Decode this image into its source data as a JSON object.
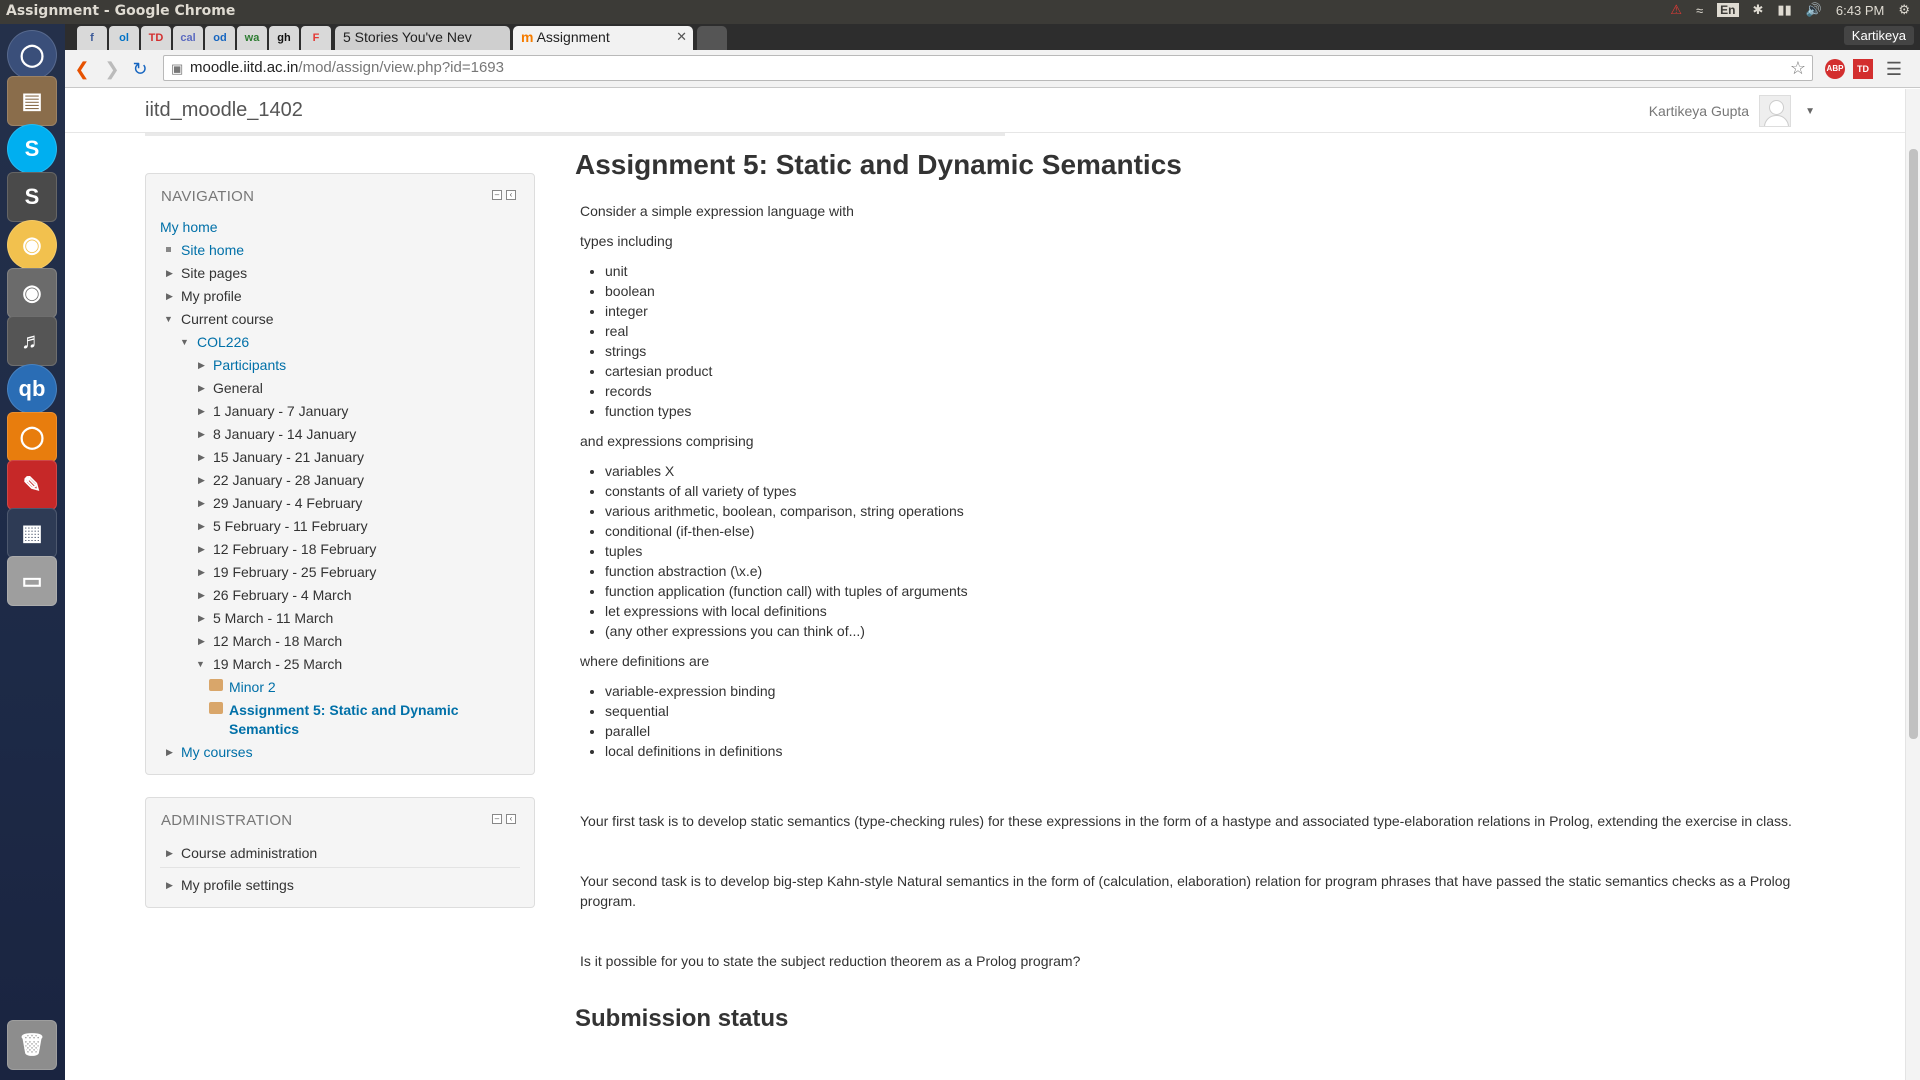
{
  "topbar": {
    "window_title": "Assignment - Google Chrome",
    "lang": "En",
    "time": "6:43 PM"
  },
  "launcher": {
    "apps": [
      "dash",
      "files",
      "skype",
      "sublime-text",
      "chrome",
      "rhythmbox",
      "volume",
      "qbittorrent",
      "blender",
      "evince",
      "workspace-switcher",
      "disk",
      "trash"
    ]
  },
  "chrome": {
    "user": "Kartikeya",
    "pinned_tabs": [
      "f",
      "ol",
      "TD",
      "cal",
      "od",
      "wa",
      "gh",
      "F"
    ],
    "tabs": [
      {
        "label": "5 Stories You've Nev"
      },
      {
        "label": "Assignment"
      }
    ],
    "url_host": "moodle.iitd.ac.in",
    "url_path": "/mod/assign/view.php?id=1693"
  },
  "moodle": {
    "site_name": "iitd_moodle_1402",
    "user_name": "Kartikeya Gupta"
  },
  "navigation": {
    "title": "NAVIGATION",
    "items": [
      {
        "label": "My home",
        "type": "link"
      },
      {
        "label": "Site home",
        "type": "link"
      },
      {
        "label": "Site pages",
        "type": "text"
      },
      {
        "label": "My profile",
        "type": "text"
      },
      {
        "label": "Current course",
        "type": "text"
      },
      {
        "label": "COL226",
        "type": "link"
      },
      {
        "label": "Participants",
        "type": "link"
      },
      {
        "label": "General",
        "type": "text"
      },
      {
        "label": "1 January - 7 January",
        "type": "text"
      },
      {
        "label": "8 January - 14 January",
        "type": "text"
      },
      {
        "label": "15 January - 21 January",
        "type": "text"
      },
      {
        "label": "22 January - 28 January",
        "type": "text"
      },
      {
        "label": "29 January - 4 February",
        "type": "text"
      },
      {
        "label": "5 February - 11 February",
        "type": "text"
      },
      {
        "label": "12 February - 18 February",
        "type": "text"
      },
      {
        "label": "19 February - 25 February",
        "type": "text"
      },
      {
        "label": "26 February - 4 March",
        "type": "text"
      },
      {
        "label": "5 March - 11 March",
        "type": "text"
      },
      {
        "label": "12 March - 18 March",
        "type": "text"
      },
      {
        "label": "19 March - 25 March",
        "type": "text"
      },
      {
        "label": "Minor 2",
        "type": "link"
      },
      {
        "label": "Assignment 5: Static and Dynamic Semantics",
        "type": "current"
      },
      {
        "label": "My courses",
        "type": "link"
      }
    ]
  },
  "administration": {
    "title": "ADMINISTRATION",
    "items": [
      "Course administration",
      "My profile settings"
    ]
  },
  "assignment": {
    "title": "Assignment 5: Static and Dynamic Semantics",
    "intro1": "Consider a simple expression language with",
    "intro2": "types including",
    "types": [
      "unit",
      "boolean",
      "integer",
      "real",
      "strings",
      "cartesian product",
      "records",
      "function types"
    ],
    "expr_intro": "and expressions comprising",
    "expressions": [
      "variables X",
      "constants of all variety of types",
      "various arithmetic, boolean, comparison, string operations",
      "conditional (if-then-else)",
      "tuples",
      "function abstraction (\\x.e)",
      "function application (function call) with tuples of arguments",
      "let expressions with local definitions",
      "(any other expressions you can think of...)"
    ],
    "def_intro": "where definitions are",
    "definitions": [
      "variable-expression binding",
      "sequential",
      "parallel",
      "local definitions in definitions"
    ],
    "task1": "Your first task is to develop static semantics (type-checking rules) for these expressions in the form of a hastype  and associated type-elaboration relations in Prolog, extending the exercise in class.",
    "task2": "Your second task is to develop big-step Kahn-style Natural semantics in the form of  (calculation, elaboration)  relation for program phrases that have passed the static semantics checks as a Prolog program.",
    "question": "Is it possible for you to state the subject reduction theorem as a Prolog program?",
    "submission_heading": "Submission status"
  }
}
